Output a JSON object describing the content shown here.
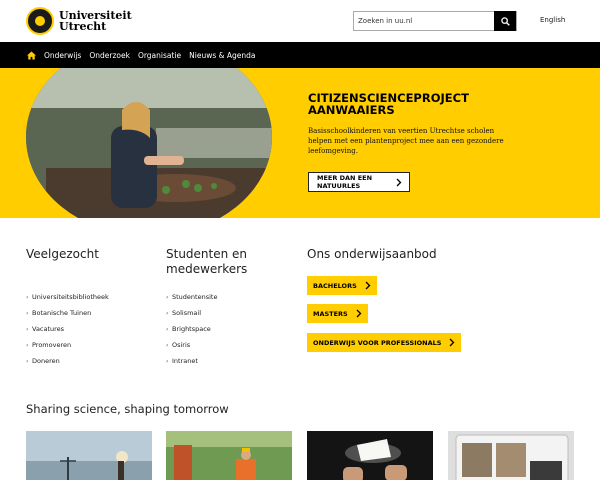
{
  "header": {
    "logo_line1": "Universiteit",
    "logo_line2": "Utrecht",
    "search_placeholder": "Zoeken in uu.nl",
    "language": "English"
  },
  "nav": {
    "items": [
      "Onderwijs",
      "Onderzoek",
      "Organisatie",
      "Nieuws & Agenda"
    ]
  },
  "hero": {
    "title_line1": "CITIZENSCIENCEPROJECT",
    "title_line2": "AANWAAIERS",
    "text": "Basisschoolkinderen van veertien Utrechtse scholen helpen met een plantenproject mee aan een gezondere leefomgeving.",
    "button": "MEER DAN EEN NATUURLES"
  },
  "columns": {
    "popular": {
      "heading": "Veelgezocht",
      "links": [
        "Universiteitsbibliotheek",
        "Botanische Tuinen",
        "Vacatures",
        "Promoveren",
        "Doneren"
      ]
    },
    "staff": {
      "heading_line1": "Studenten en",
      "heading_line2": "medewerkers",
      "links": [
        "Studentensite",
        "Solismail",
        "Brightspace",
        "Osiris",
        "Intranet"
      ]
    },
    "education": {
      "heading": "Ons onderwijsaanbod",
      "buttons": [
        "BACHELORS",
        "MASTERS",
        "ONDERWIJS VOOR PROFESSIONALS"
      ]
    }
  },
  "section": {
    "title": "Sharing science, shaping tomorrow"
  },
  "colors": {
    "brand_yellow": "#ffcd00",
    "nav_black": "#000000"
  }
}
